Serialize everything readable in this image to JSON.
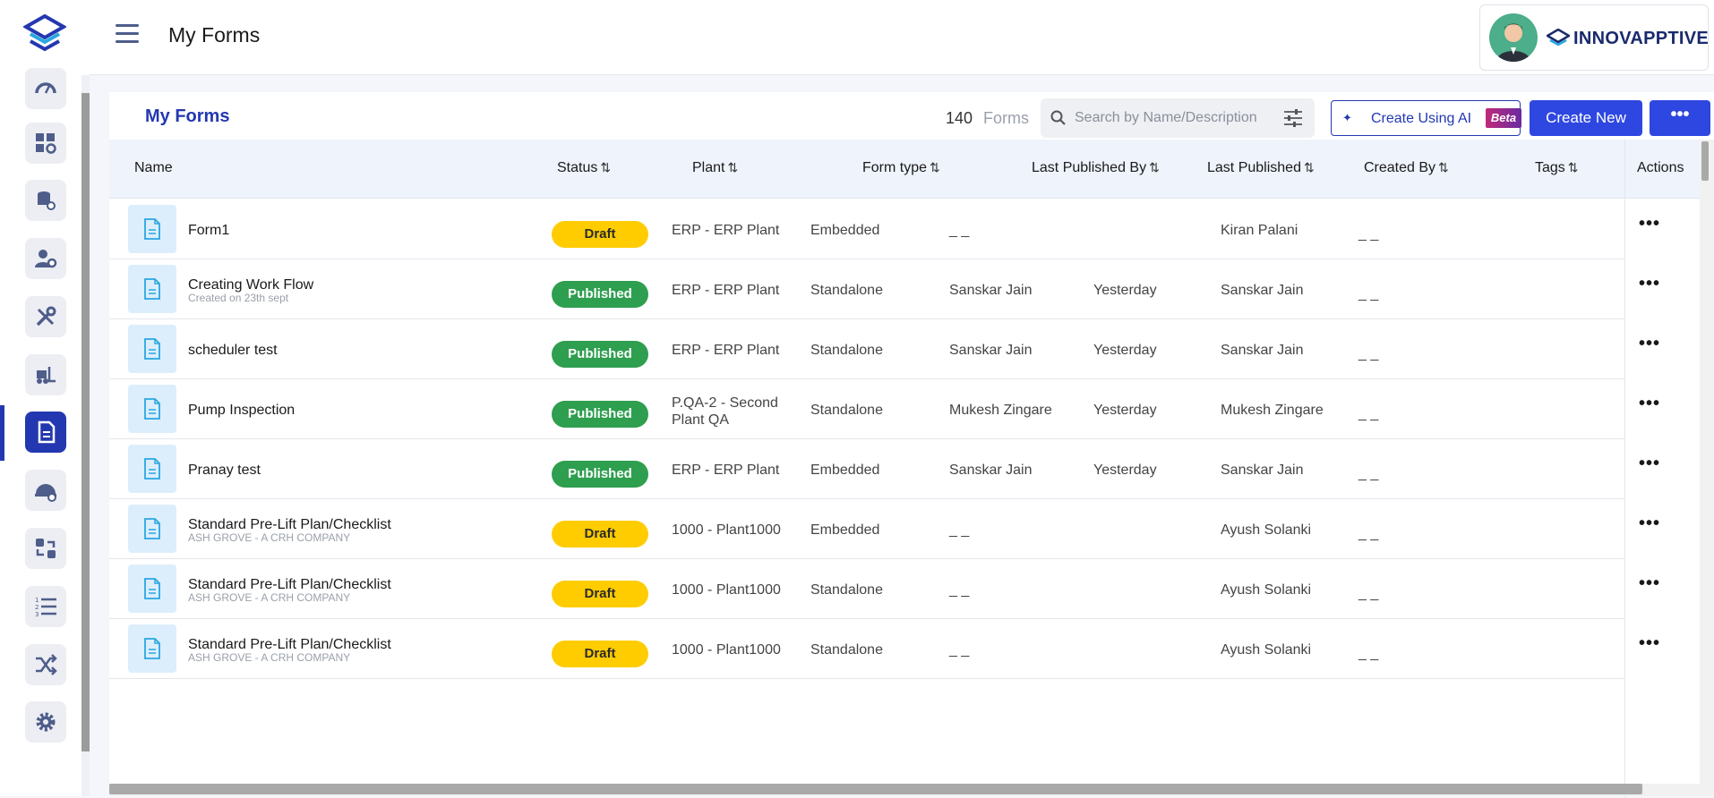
{
  "header": {
    "title": "My Forms",
    "brand_name": "INNOVAPPTIVE"
  },
  "sidebar": {
    "items": [
      {
        "icon": "dashboard-gauge-icon"
      },
      {
        "icon": "apps-settings-icon"
      },
      {
        "icon": "database-settings-icon"
      },
      {
        "icon": "user-settings-icon"
      },
      {
        "icon": "tools-icon"
      },
      {
        "icon": "forklift-icon"
      },
      {
        "icon": "forms-icon",
        "active": true
      },
      {
        "icon": "safety-helmet-icon"
      },
      {
        "icon": "sync-icon"
      },
      {
        "icon": "numbered-list-icon"
      },
      {
        "icon": "shuffle-icon"
      },
      {
        "icon": "gear-icon"
      }
    ]
  },
  "toolbar": {
    "title": "My Forms",
    "count": "140",
    "count_label": "Forms",
    "search_placeholder": "Search by Name/Description",
    "ai_button_label": "Create Using AI",
    "beta_label": "Beta",
    "create_button_label": "Create New",
    "more_label": "•••"
  },
  "table": {
    "columns": [
      {
        "label": "Name",
        "sortable": false
      },
      {
        "label": "Status",
        "sortable": true
      },
      {
        "label": "Plant",
        "sortable": true
      },
      {
        "label": "Form type",
        "sortable": true
      },
      {
        "label": "Last Published By",
        "sortable": true
      },
      {
        "label": "Last Published",
        "sortable": true
      },
      {
        "label": "Created By",
        "sortable": true
      },
      {
        "label": "Tags",
        "sortable": true
      },
      {
        "label": "Actions",
        "sortable": false
      }
    ],
    "sort_glyph": "⇅",
    "action_glyph": "•••",
    "rows": [
      {
        "name": "Form1",
        "sub": "",
        "status": "Draft",
        "status_kind": "draft",
        "plant": "ERP - ERP Plant",
        "form_type": "Embedded",
        "last_published_by": "_ _",
        "last_published": "",
        "created_by": "Kiran Palani",
        "tags": "_ _"
      },
      {
        "name": "Creating Work Flow",
        "sub": "Created on 23th sept",
        "status": "Published",
        "status_kind": "published",
        "plant": "ERP - ERP Plant",
        "form_type": "Standalone",
        "last_published_by": "Sanskar Jain",
        "last_published": "Yesterday",
        "created_by": "Sanskar Jain",
        "tags": "_ _"
      },
      {
        "name": "scheduler test",
        "sub": "",
        "status": "Published",
        "status_kind": "published",
        "plant": "ERP - ERP Plant",
        "form_type": "Standalone",
        "last_published_by": "Sanskar Jain",
        "last_published": "Yesterday",
        "created_by": "Sanskar Jain",
        "tags": "_ _"
      },
      {
        "name": "Pump Inspection",
        "sub": "",
        "status": "Published",
        "status_kind": "published",
        "plant": "P.QA-2 - Second Plant QA",
        "form_type": "Standalone",
        "last_published_by": "Mukesh Zingare",
        "last_published": "Yesterday",
        "created_by": "Mukesh Zingare",
        "tags": "_ _"
      },
      {
        "name": "Pranay test",
        "sub": "",
        "status": "Published",
        "status_kind": "published",
        "plant": "ERP - ERP Plant",
        "form_type": "Embedded",
        "last_published_by": "Sanskar Jain",
        "last_published": "Yesterday",
        "created_by": "Sanskar Jain",
        "tags": "_ _"
      },
      {
        "name": "Standard Pre-Lift Plan/Checklist",
        "sub": "ASH GROVE - A CRH COMPANY",
        "status": "Draft",
        "status_kind": "draft",
        "plant": "1000 - Plant1000",
        "form_type": "Embedded",
        "last_published_by": "_ _",
        "last_published": "",
        "created_by": "Ayush Solanki",
        "tags": "_ _"
      },
      {
        "name": "Standard Pre-Lift Plan/Checklist",
        "sub": "ASH GROVE - A CRH COMPANY",
        "status": "Draft",
        "status_kind": "draft",
        "plant": "1000 - Plant1000",
        "form_type": "Standalone",
        "last_published_by": "_ _",
        "last_published": "",
        "created_by": "Ayush Solanki",
        "tags": "_ _"
      },
      {
        "name": "Standard Pre-Lift Plan/Checklist",
        "sub": "ASH GROVE - A CRH COMPANY",
        "status": "Draft",
        "status_kind": "draft",
        "plant": "1000 - Plant1000",
        "form_type": "Standalone",
        "last_published_by": "_ _",
        "last_published": "",
        "created_by": "Ayush Solanki",
        "tags": "_ _"
      }
    ]
  },
  "colors": {
    "primary": "#2338b0",
    "button": "#2e47e0",
    "draft": "#ffcc00",
    "published": "#2e9e4f"
  }
}
